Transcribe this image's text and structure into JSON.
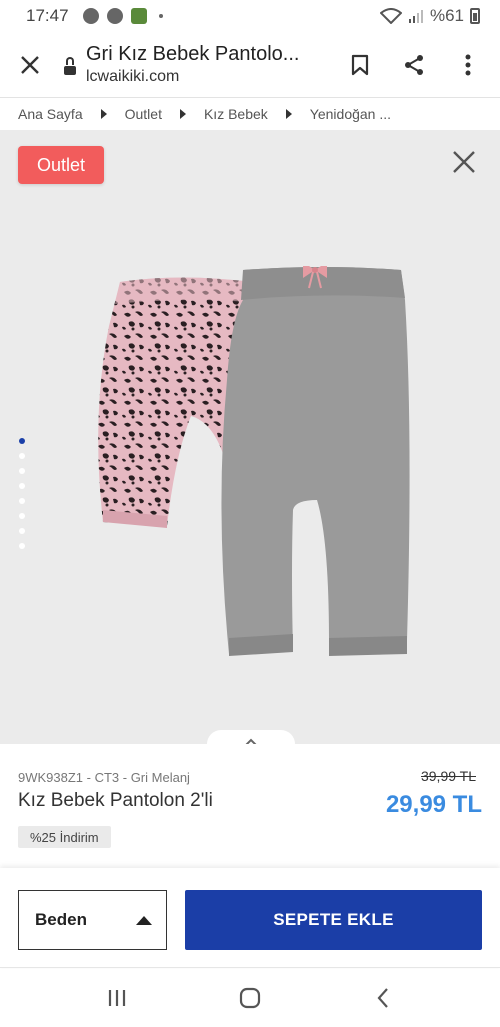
{
  "status_bar": {
    "time": "17:47",
    "battery": "%61"
  },
  "browser": {
    "page_title": "Gri Kız Bebek Pantolo...",
    "url": "lcwaikiki.com"
  },
  "breadcrumb": {
    "items": [
      "Ana Sayfa",
      "Outlet",
      "Kız Bebek",
      "Yenidoğan ..."
    ]
  },
  "gallery": {
    "badge": "Outlet",
    "dots_total": 8,
    "active_dot": 0
  },
  "product": {
    "sku": "9WK938Z1 - CT3 - Gri Melanj",
    "name": "Kız Bebek Pantolon 2'li",
    "old_price": "39,99 TL",
    "new_price": "29,99 TL",
    "discount": "%25 İndirim"
  },
  "actions": {
    "size_label": "Beden",
    "add_to_cart": "SEPETE EKLE"
  },
  "colors": {
    "badge": "#f25c5c",
    "price": "#3a8be0",
    "cart_button": "#1b3ea7",
    "active_dot": "#1a3fa8"
  }
}
